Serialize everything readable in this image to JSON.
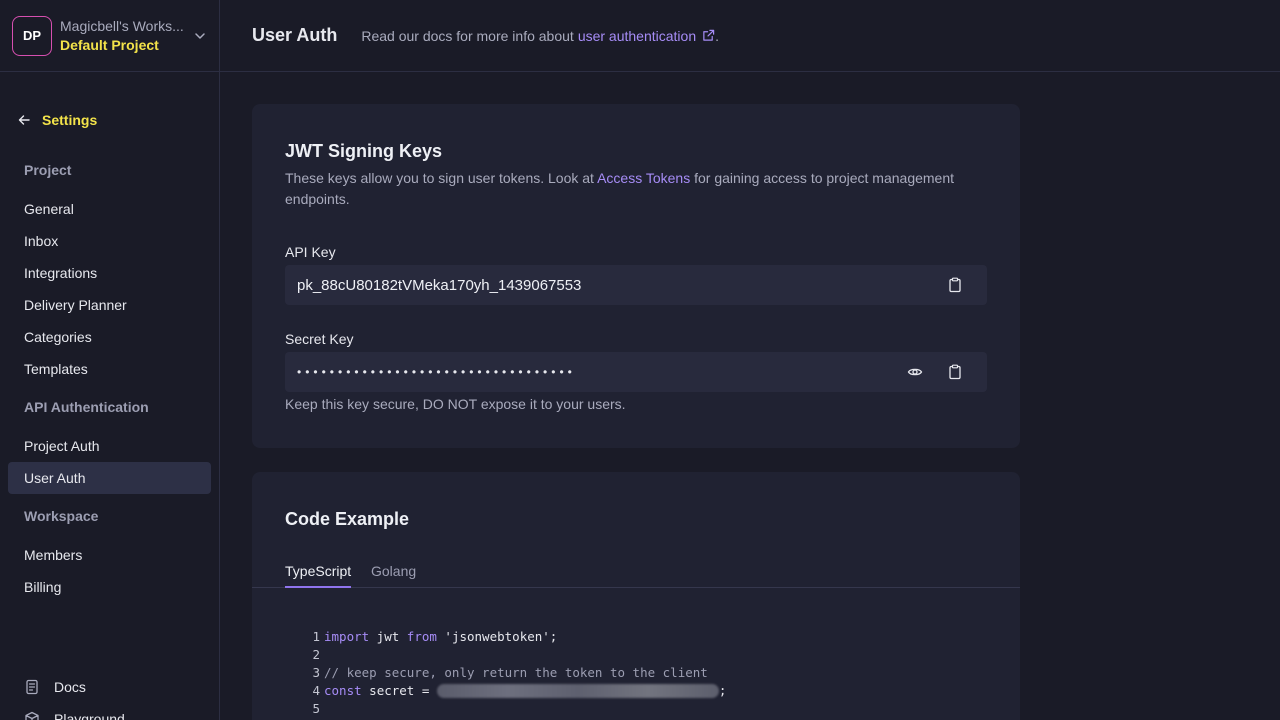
{
  "workspace": {
    "avatar_initials": "DP",
    "name": "Magicbell's Works...",
    "project": "Default Project"
  },
  "sidebar": {
    "back_label": "Settings",
    "groups": [
      {
        "heading": "Project",
        "items": [
          "General",
          "Inbox",
          "Integrations",
          "Delivery Planner",
          "Categories",
          "Templates"
        ]
      },
      {
        "heading": "API Authentication",
        "items": [
          "Project Auth",
          "User Auth"
        ]
      },
      {
        "heading": "Workspace",
        "items": [
          "Members",
          "Billing"
        ]
      }
    ],
    "active_item": "User Auth",
    "footer": {
      "docs": "Docs",
      "playground": "Playground"
    }
  },
  "header": {
    "title": "User Auth",
    "desc_prefix": "Read our docs for more info about",
    "desc_link": "user authentication",
    "desc_suffix": "."
  },
  "jwt_card": {
    "title": "JWT Signing Keys",
    "desc_prefix": "These keys allow you to sign user tokens. Look at",
    "desc_link": "Access Tokens",
    "desc_suffix": "for gaining access to project management endpoints.",
    "api_key_label": "API Key",
    "api_key_value": "pk_88cU80182tVMeka170yh_1439067553",
    "secret_key_label": "Secret Key",
    "secret_key_masked": "••••••••••••••••••••••••••••••••••",
    "secret_hint": "Keep this key secure, DO NOT expose it to your users."
  },
  "code_card": {
    "title": "Code Example",
    "tabs": [
      "TypeScript",
      "Golang"
    ],
    "active_tab": "TypeScript",
    "lines": {
      "l1": {
        "num": "1",
        "kw1": "import",
        "mid": " jwt ",
        "kw2": "from",
        "rest": " 'jsonwebtoken';"
      },
      "l2": {
        "num": "2"
      },
      "l3": {
        "num": "3",
        "comment": "// keep secure, only return the token to the client"
      },
      "l4": {
        "num": "4",
        "kw": "const",
        "mid": " secret = ",
        "end": ";"
      },
      "l5": {
        "num": "5"
      }
    }
  },
  "colors": {
    "accent": "#a68cf6",
    "highlight": "#f3e34a",
    "background": "#1a1b27",
    "card": "#202232"
  }
}
